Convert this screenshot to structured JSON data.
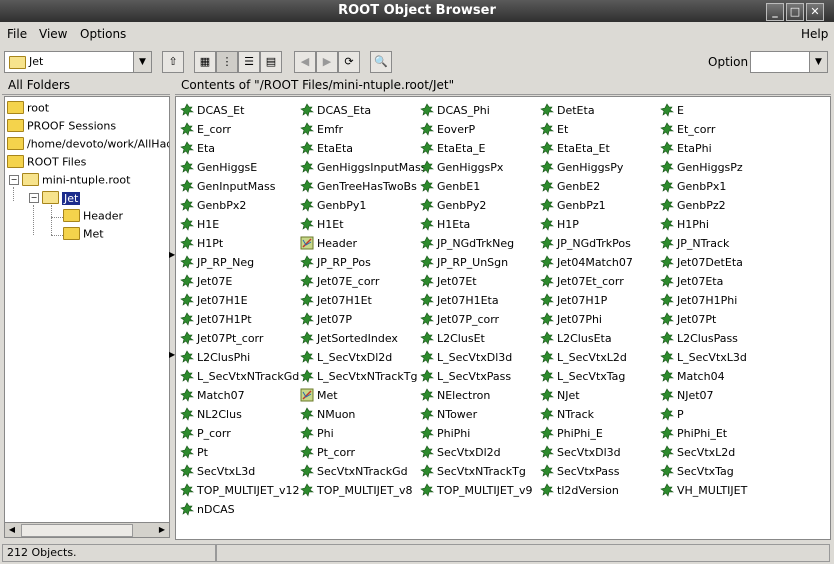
{
  "window": {
    "title": "ROOT Object Browser"
  },
  "menu": {
    "file": "File",
    "view": "View",
    "options": "Options",
    "help": "Help"
  },
  "toolbar": {
    "path_combo": "Jet",
    "option_label": "Option",
    "option_value": ""
  },
  "left_panel": {
    "header": "All Folders"
  },
  "tree": {
    "root": "root",
    "proof": "PROOF Sessions",
    "home": "/home/devoto/work/AllHadronic",
    "root_files": "ROOT Files",
    "mini": "mini-ntuple.root",
    "jet": "Jet",
    "header": "Header",
    "met": "Met"
  },
  "content": {
    "header": "Contents of \"/ROOT Files/mini-ntuple.root/Jet\"",
    "items": [
      "DCAS_Et",
      "DCAS_Eta",
      "DCAS_Phi",
      "DetEta",
      "E",
      "E_corr",
      "Emfr",
      "EoverP",
      "Et",
      "Et_corr",
      "Eta",
      "EtaEta",
      "EtaEta_E",
      "EtaEta_Et",
      "EtaPhi",
      "GenHiggsE",
      "GenHiggsInputMass",
      "GenHiggsPx",
      "GenHiggsPy",
      "GenHiggsPz",
      "GenInputMass",
      "GenTreeHasTwoBs",
      "GenbE1",
      "GenbE2",
      "GenbPx1",
      "GenbPx2",
      "GenbPy1",
      "GenbPy2",
      "GenbPz1",
      "GenbPz2",
      "H1E",
      "H1Et",
      "H1Eta",
      "H1P",
      "H1Phi",
      "H1Pt",
      "Header",
      "JP_NGdTrkNeg",
      "JP_NGdTrkPos",
      "JP_NTrack",
      "JP_RP_Neg",
      "JP_RP_Pos",
      "JP_RP_UnSgn",
      "Jet04Match07",
      "Jet07DetEta",
      "Jet07E",
      "Jet07E_corr",
      "Jet07Et",
      "Jet07Et_corr",
      "Jet07Eta",
      "Jet07H1E",
      "Jet07H1Et",
      "Jet07H1Eta",
      "Jet07H1P",
      "Jet07H1Phi",
      "Jet07H1Pt",
      "Jet07P",
      "Jet07P_corr",
      "Jet07Phi",
      "Jet07Pt",
      "Jet07Pt_corr",
      "JetSortedIndex",
      "L2ClusEt",
      "L2ClusEta",
      "L2ClusPass",
      "L2ClusPhi",
      "L_SecVtxDl2d",
      "L_SecVtxDl3d",
      "L_SecVtxL2d",
      "L_SecVtxL3d",
      "L_SecVtxNTrackGd",
      "L_SecVtxNTrackTg",
      "L_SecVtxPass",
      "L_SecVtxTag",
      "Match04",
      "Match07",
      "Met",
      "NElectron",
      "NJet",
      "NJet07",
      "NL2Clus",
      "NMuon",
      "NTower",
      "NTrack",
      "P",
      "P_corr",
      "Phi",
      "PhiPhi",
      "PhiPhi_E",
      "PhiPhi_Et",
      "Pt",
      "Pt_corr",
      "SecVtxDl2d",
      "SecVtxDl3d",
      "SecVtxL2d",
      "SecVtxL3d",
      "SecVtxNTrackGd",
      "SecVtxNTrackTg",
      "SecVtxPass",
      "SecVtxTag",
      "TOP_MULTIJET_v12",
      "TOP_MULTIJET_v8",
      "TOP_MULTIJET_v9",
      "tl2dVersion",
      "VH_MULTIJET",
      "nDCAS"
    ],
    "folder_items": [
      "Header",
      "Met"
    ]
  },
  "status": {
    "objects": "212 Objects."
  }
}
